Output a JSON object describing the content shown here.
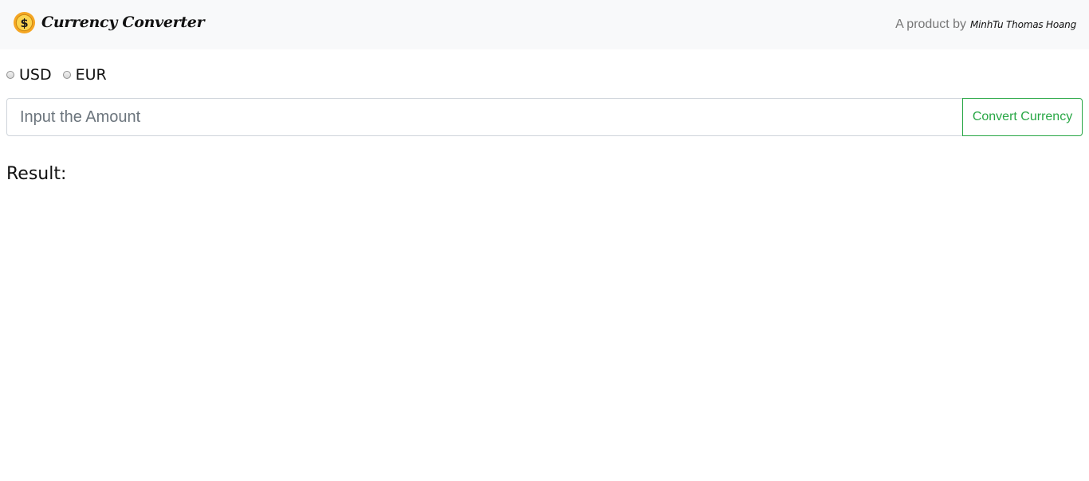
{
  "navbar": {
    "brand_icon": "dollar-coin-icon",
    "brand_title": "Currency Converter",
    "credit_prefix": "A product by",
    "credit_author": "MinhTu Thomas Hoang"
  },
  "currency": {
    "options": [
      {
        "label": "USD",
        "checked": false
      },
      {
        "label": "EUR",
        "checked": false
      }
    ]
  },
  "converter": {
    "amount_value": "",
    "amount_placeholder": "Input the Amount",
    "convert_label": "Convert Currency"
  },
  "result": {
    "heading": "Result:",
    "value": ""
  },
  "colors": {
    "navbar_bg": "#f8f9fa",
    "accent_green": "#28a745",
    "coin_gold": "#f5a623",
    "text_dark": "#111111",
    "muted": "#777777"
  }
}
